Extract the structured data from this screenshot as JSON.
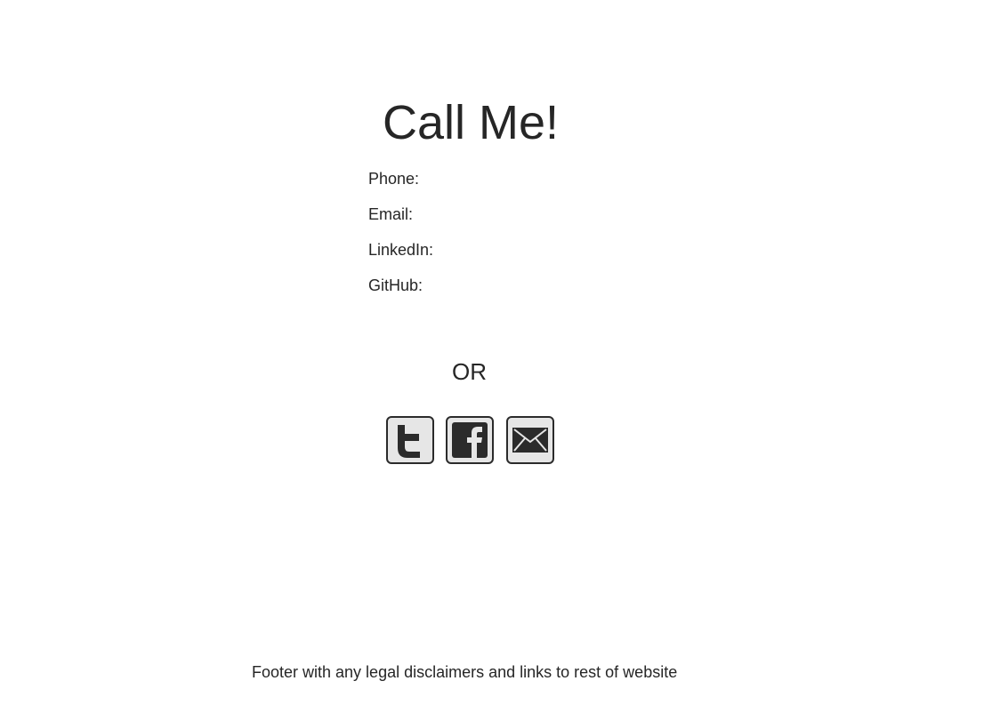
{
  "page": {
    "title": "Call Me!",
    "contacts": [
      {
        "label": "Phone:"
      },
      {
        "label": "Email:"
      },
      {
        "label": "LinkedIn:"
      },
      {
        "label": "GitHub:"
      }
    ],
    "separator": "OR",
    "social": [
      {
        "icon": "twitter-icon"
      },
      {
        "icon": "facebook-icon"
      },
      {
        "icon": "email-icon"
      }
    ]
  },
  "footer": {
    "text": "Footer with any legal disclaimers and links to rest of website"
  },
  "colors": {
    "text": "#262626",
    "icon_fill": "#e6e6e6",
    "icon_stroke": "#2b2b2b"
  }
}
